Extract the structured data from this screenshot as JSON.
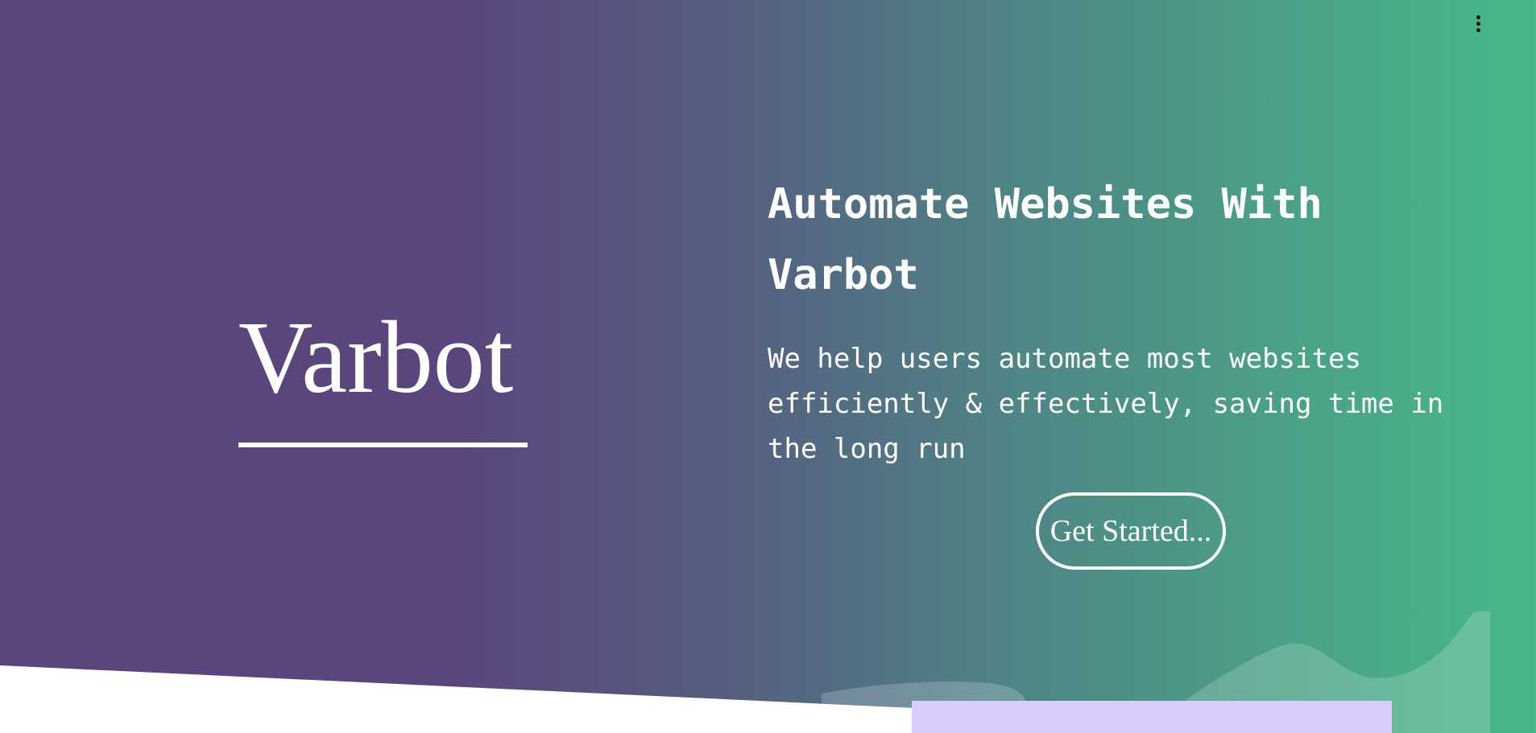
{
  "brand": {
    "logo_text": "Varbot"
  },
  "hero": {
    "headline": "Automate Websites With Varbot",
    "subtext": "We help users automate most websites efficiently & effectively, saving time in the long run",
    "cta_label": "Get Started..."
  },
  "icons": {
    "menu": "more-vertical-icon"
  },
  "colors": {
    "gradient_start": "#5a457c",
    "gradient_end": "#48b888",
    "text": "#ffffff",
    "card": "#d8cdfd"
  }
}
